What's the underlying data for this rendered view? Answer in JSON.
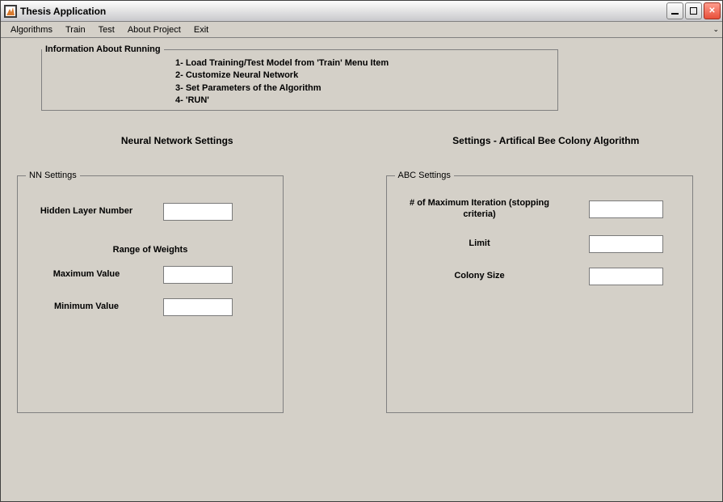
{
  "window": {
    "title": "Thesis Application"
  },
  "menubar": {
    "items": [
      "Algorithms",
      "Train",
      "Test",
      "About Project",
      "Exit"
    ]
  },
  "info": {
    "legend": "Information About Running",
    "lines": [
      "1- Load Training/Test Model from 'Train' Menu Item",
      "2- Customize Neural Network",
      "3- Set Parameters of the Algorithm",
      "4- 'RUN'"
    ]
  },
  "left": {
    "heading": "Neural Network Settings",
    "box_legend": "NN Settings",
    "hidden_layer_label": "Hidden Layer Number",
    "hidden_layer_value": "",
    "range_heading": "Range of Weights",
    "max_label": "Maximum Value",
    "max_value": "",
    "min_label": "Minimum Value",
    "min_value": ""
  },
  "right": {
    "heading": "Settings - Artifical Bee Colony Algorithm",
    "box_legend": "ABC Settings",
    "max_iter_label": "# of Maximum Iteration (stopping criteria)",
    "max_iter_value": "",
    "limit_label": "Limit",
    "limit_value": "",
    "colony_label": "Colony Size",
    "colony_value": ""
  }
}
